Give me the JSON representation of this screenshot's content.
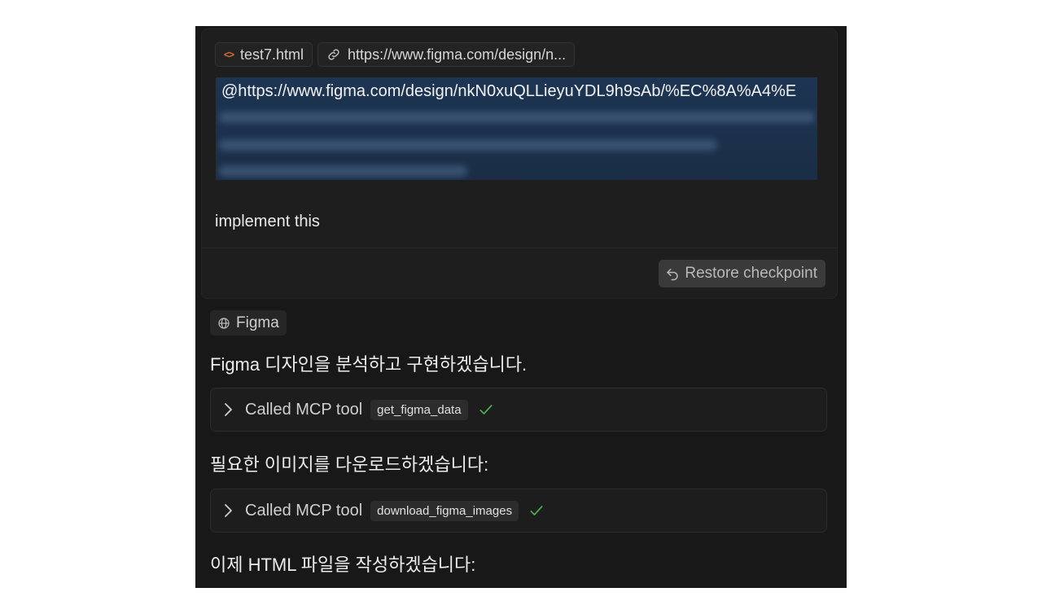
{
  "user_message": {
    "context_chips": [
      {
        "icon": "code-icon",
        "label": "test7.html"
      },
      {
        "icon": "link-icon",
        "label": "https://www.figma.com/design/n..."
      }
    ],
    "mention_text": "@https://www.figma.com/design/nkN0xuQLLieyuYDL9h9sAb/%EC%8A%A4%E",
    "body": "implement this",
    "restore_label": "Restore checkpoint"
  },
  "assistant": {
    "source_chip": {
      "icon": "globe-icon",
      "label": "Figma"
    },
    "line1": "Figma 디자인을 분석하고 구현하겠습니다.",
    "tool1": {
      "label": "Called MCP tool",
      "name": "get_figma_data",
      "status": "check-icon"
    },
    "line2": "필요한 이미지를 다운로드하겠습니다:",
    "tool2": {
      "label": "Called MCP tool",
      "name": "download_figma_images",
      "status": "check-icon"
    },
    "line3": "이제 HTML 파일을 작성하겠습니다:"
  },
  "colors": {
    "panel": "#181818",
    "accent_check": "#4caf50",
    "code_icon": "#e06c35",
    "mention_bg": "#1d3553"
  }
}
